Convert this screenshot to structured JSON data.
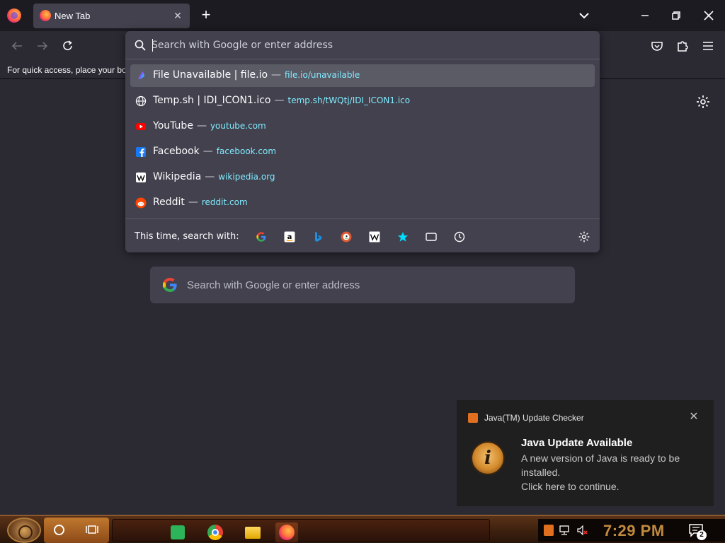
{
  "window": {
    "active_tab": {
      "title": "New Tab"
    }
  },
  "bookmarks_bar": {
    "hint_text": "For quick access, place your bookmarks here on the bookmarks toolbar."
  },
  "urlbar": {
    "placeholder": "Search with Google or enter address",
    "value": "",
    "results": [
      {
        "title": "File Unavailable | file.io",
        "url": "file.io/unavailable",
        "icon": "file-io-icon",
        "selected": true
      },
      {
        "title": "Temp.sh | IDI_ICON1.ico",
        "url": "temp.sh/tWQtj/IDI_ICON1.ico",
        "icon": "globe-icon",
        "selected": false
      },
      {
        "title": "YouTube",
        "url": "youtube.com",
        "icon": "youtube-icon",
        "selected": false
      },
      {
        "title": "Facebook",
        "url": "facebook.com",
        "icon": "facebook-icon",
        "selected": false
      },
      {
        "title": "Wikipedia",
        "url": "wikipedia.org",
        "icon": "wikipedia-icon",
        "selected": false
      },
      {
        "title": "Reddit",
        "url": "reddit.com",
        "icon": "reddit-icon",
        "selected": false
      }
    ],
    "separator": "—",
    "search_with_label": "This time, search with:",
    "engines": [
      "google-icon",
      "amazon-icon",
      "bing-icon",
      "duckduckgo-icon",
      "wikipedia-icon",
      "bookmarks-star-icon",
      "tabs-icon",
      "history-clock-icon"
    ]
  },
  "content_search": {
    "placeholder": "Search with Google or enter address"
  },
  "notification": {
    "app_name": "Java(TM) Update Checker",
    "title": "Java Update Available",
    "body_line1": "A new version of Java is ready to be installed.",
    "body_line2": "Click here to continue."
  },
  "taskbar": {
    "clock": "7:29 PM",
    "notification_count": "2"
  },
  "colors": {
    "url_accent": "#80ebff",
    "popup_bg": "#42414d",
    "page_bg": "#2b2a33",
    "tabstrip_bg": "#1c1b22"
  }
}
